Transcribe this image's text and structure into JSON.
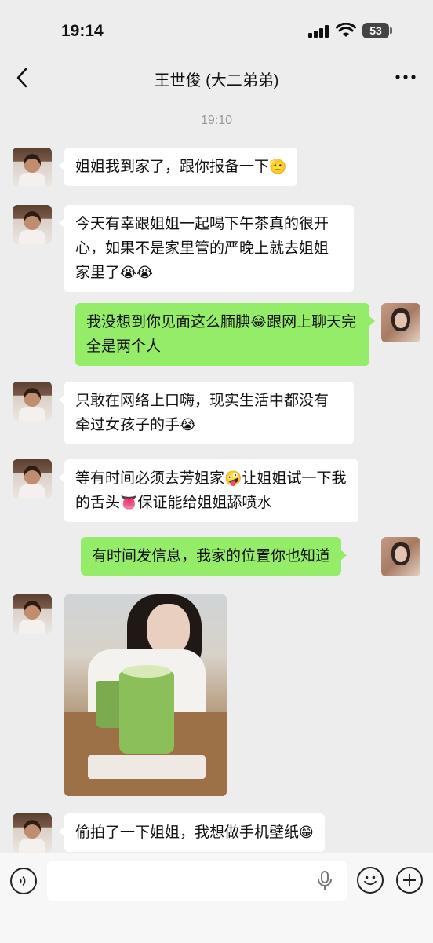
{
  "status_bar": {
    "time": "19:14",
    "battery": "53"
  },
  "nav": {
    "title": "王世俊 (大二弟弟)"
  },
  "timestamp": "19:10",
  "messages": [
    {
      "side": "in",
      "text": "姐姐我到家了，跟你报备一下",
      "emoji": "🫡"
    },
    {
      "side": "in",
      "text": "今天有幸跟姐姐一起喝下午茶真的很开心，如果不是家里管的严晚上就去姐姐家里了",
      "emoji": "😭😭"
    },
    {
      "side": "out",
      "text_a": "我没想到你见面这么腼腆",
      "emoji": "😂",
      "text_b": "跟网上聊天完全是两个人"
    },
    {
      "side": "in",
      "text": "只敢在网络上口嗨，现实生活中都没有牵过女孩子的手",
      "emoji": "😭"
    },
    {
      "side": "in",
      "text_a": "等有时间必须去芳姐家",
      "emoji_a": "🤪",
      "text_b": "让姐姐试一下我的舌头",
      "emoji_b": "👅",
      "text_c": "保证能给姐姐舔喷水"
    },
    {
      "side": "out",
      "text": "有时间发信息，我家的位置你也知道"
    },
    {
      "side": "in",
      "type": "image"
    },
    {
      "side": "in",
      "text": "偷拍了一下姐姐，我想做手机壁纸",
      "emoji": "😁"
    }
  ]
}
